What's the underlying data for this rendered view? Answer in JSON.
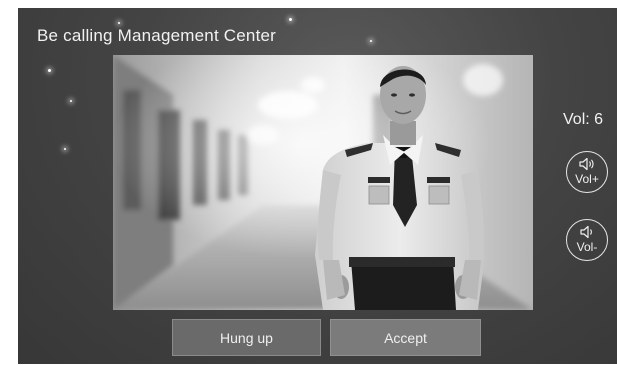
{
  "call_status": {
    "title": "Be calling Management Center"
  },
  "volume": {
    "label": "Vol: 6",
    "up_label": "Vol+",
    "up_icon": "speaker-loud-icon",
    "down_label": "Vol-",
    "down_icon": "speaker-quiet-icon"
  },
  "video": {
    "description_icon": "caller-video-feed"
  },
  "actions": {
    "hang_up_label": "Hung up",
    "accept_label": "Accept"
  },
  "colors": {
    "background": "#404040",
    "text": "#f2f2f2",
    "hang_button": "#6a6a6a",
    "accept_button": "#7b7b7b"
  }
}
